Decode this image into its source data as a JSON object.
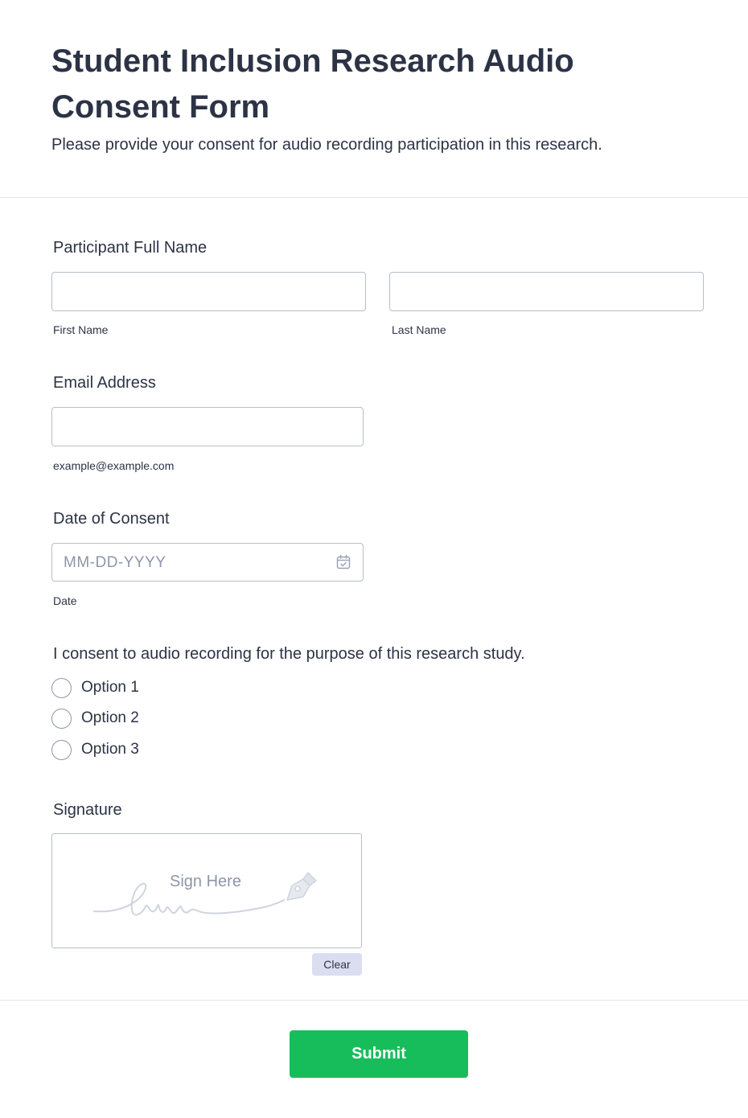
{
  "header": {
    "title": "Student Inclusion Research Audio Consent Form",
    "subtitle": "Please provide your consent for audio recording participation in this research."
  },
  "fields": {
    "full_name": {
      "label": "Participant Full Name",
      "first_sublabel": "First Name",
      "last_sublabel": "Last Name",
      "first_value": "",
      "last_value": ""
    },
    "email": {
      "label": "Email Address",
      "sublabel": "example@example.com",
      "value": ""
    },
    "date": {
      "label": "Date of Consent",
      "placeholder": "MM-DD-YYYY",
      "sublabel": "Date",
      "icon": "calendar-icon"
    },
    "consent": {
      "label": "I consent to audio recording for the purpose of this research study.",
      "options": [
        "Option 1",
        "Option 2",
        "Option 3"
      ]
    },
    "signature": {
      "label": "Signature",
      "placeholder": "Sign Here",
      "icon": "pen-nib-icon",
      "clear_label": "Clear"
    }
  },
  "footer": {
    "submit_label": "Submit"
  },
  "colors": {
    "text": "#2c3345",
    "muted": "#8d96a8",
    "border": "#b8bdc9",
    "submit": "#18bd5b",
    "clear_bg": "#dadef0"
  }
}
